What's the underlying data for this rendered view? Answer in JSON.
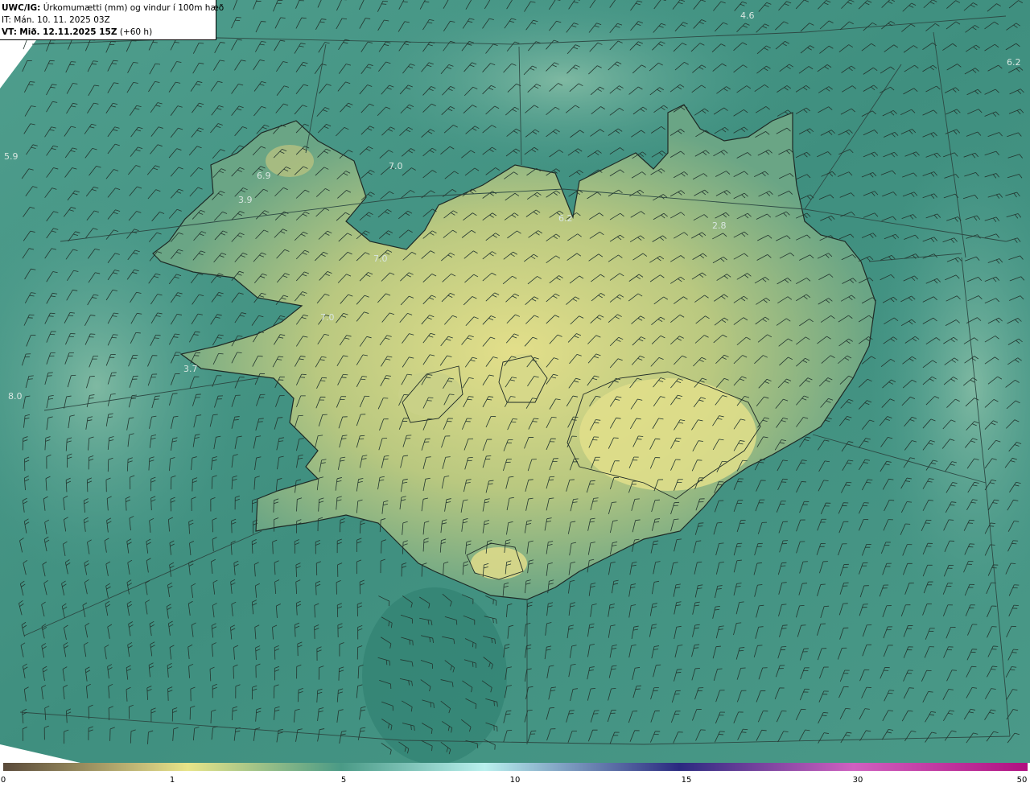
{
  "header": {
    "model": "UWC/IG:",
    "title": "Úrkomumætti (mm) og vindur í 100m hæð",
    "init_time": "IT: Mán. 10. 11. 2025 03Z",
    "valid_prefix": "VT:",
    "valid_time": "Mið. 12.11.2025 15Z",
    "lead_time": "(+60 h)"
  },
  "map_values": [
    {
      "text": "4.6"
    },
    {
      "text": "6.2"
    },
    {
      "text": "5.9"
    },
    {
      "text": "6.9"
    },
    {
      "text": "3.9"
    },
    {
      "text": "7.0"
    },
    {
      "text": "6.2"
    },
    {
      "text": "2.8"
    },
    {
      "text": "7.0"
    },
    {
      "text": "7.0"
    },
    {
      "text": "3.7"
    },
    {
      "text": "8.0"
    }
  ],
  "colorbar": {
    "ticks": [
      "0",
      "1",
      "5",
      "10",
      "15",
      "30",
      "50"
    ],
    "colors": [
      "#5a4a3a",
      "#c9c07a",
      "#e8e488",
      "#4a9a86",
      "#b9f0ee",
      "#2a2a80",
      "#d060c0",
      "#b01080"
    ]
  },
  "colors": {
    "sea": "#4c9b8d",
    "land_low": "#5fa286",
    "land_high": "#d6d987",
    "coast": "#1e2a26"
  }
}
